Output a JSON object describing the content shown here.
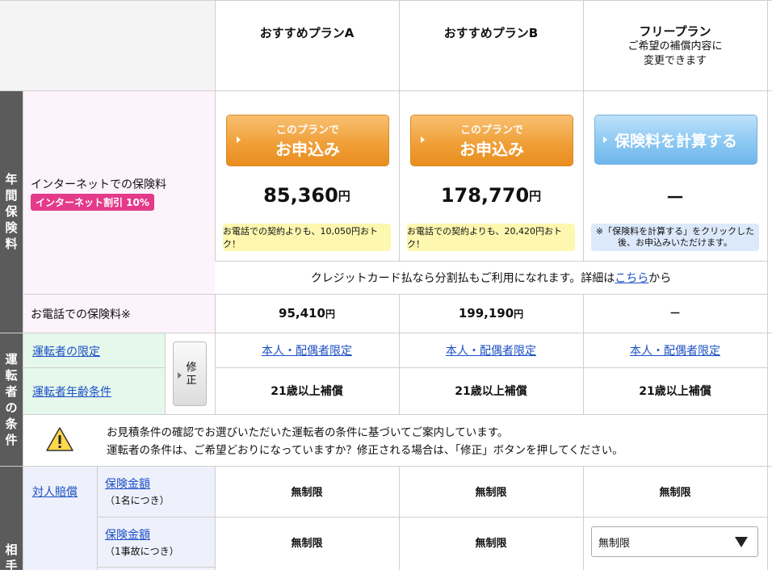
{
  "header": {
    "plan_a": "おすすめプランA",
    "plan_b": "おすすめプランB",
    "free_title": "フリープラン",
    "free_sub1": "ご希望の補償内容に",
    "free_sub2": "変更できます"
  },
  "section_labels": {
    "annual_fee": [
      "年",
      "間",
      "保",
      "険",
      "料"
    ],
    "driver_cond": [
      "運",
      "転",
      "者",
      "の",
      "条",
      "件"
    ],
    "opponent": [
      "相",
      "手"
    ]
  },
  "internet": {
    "label": "インターネットでの保険料",
    "badge": "インターネット割引 10%",
    "apply_l1": "このプランで",
    "apply_l2": "お申込み",
    "calc_button": "保険料を計算する",
    "price_a": "85,360",
    "price_b": "178,770",
    "yen": "円",
    "price_free": "－",
    "note_a": "お電話での契約よりも、10,050円おトク！",
    "note_b": "お電話での契約よりも、20,420円おトク！",
    "note_free_1": "※「保険料を計算する」をクリックした",
    "note_free_2": "後、お申込みいただけます。",
    "credit_text": "クレジットカード払なら分割払もご利用になれます。詳細は",
    "credit_link": "こちら",
    "credit_after": "から"
  },
  "phone": {
    "label": "お電話での保険料※",
    "price_a": "95,410",
    "price_b": "199,190",
    "yen": "円",
    "price_free": "－"
  },
  "driver": {
    "limit_label": "運転者の限定",
    "age_label": "運転者年齢条件",
    "edit_button": "修正",
    "limit_a": "本人・配偶者限定",
    "limit_b": "本人・配偶者限定",
    "limit_free": "本人・配偶者限定",
    "age_a": "21歳以上補償",
    "age_b": "21歳以上補償",
    "age_free": "21歳以上補償"
  },
  "notice": {
    "line1": "お見積条件の確認でお選びいただいた運転者の条件に基づいてご案内しています。",
    "line2": "運転者の条件は、ご希望どおりになっていますか？修正される場合は、「修正」ボタンを押してください。"
  },
  "bodily": {
    "label": "対人賠償",
    "amount_label_1": "保険金額",
    "amount_sub_1": "（1名につき）",
    "amount_label_2": "保険金額",
    "amount_sub_2": "（1事故につき）",
    "a1": "無制限",
    "b1": "無制限",
    "free1": "無制限",
    "a2": "無制限",
    "b2": "無制限",
    "free2_select": "無制限"
  }
}
